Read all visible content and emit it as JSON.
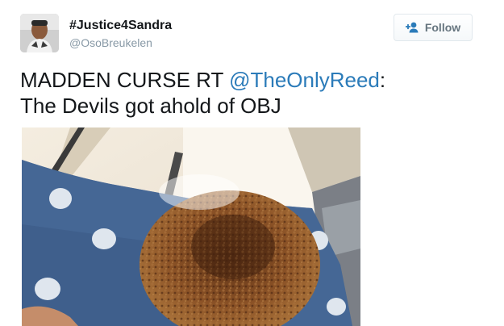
{
  "user": {
    "display_name": "#Justice4Sandra",
    "screen_name": "@OsoBreukelen",
    "avatar_icon": "profile-photo-avatar"
  },
  "follow_button": {
    "label": "Follow",
    "icon": "add-person-icon"
  },
  "tweet": {
    "text_before": "MADDEN CURSE RT ",
    "mention": "@TheOnlyReed",
    "text_after": ":",
    "line2": "The Devils got ahold of OBJ"
  },
  "colors": {
    "text": "#14171a",
    "secondary": "#8899a6",
    "link": "#2b7bb9",
    "follow_icon": "#2b7bb9",
    "button_border": "#e1e8ed"
  }
}
